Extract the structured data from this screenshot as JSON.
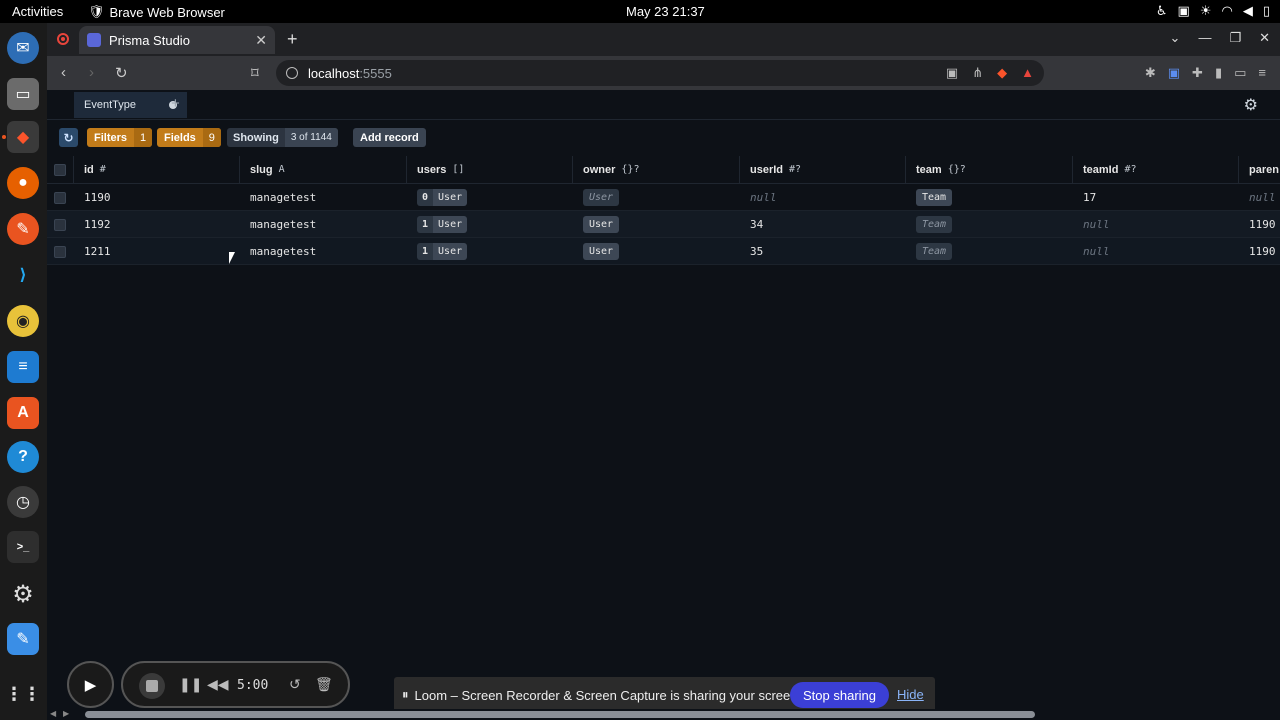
{
  "topbar": {
    "activities": "Activities",
    "app_name": "Brave Web Browser",
    "clock": "May 23  21:37"
  },
  "browser": {
    "tab_title": "Prisma Studio",
    "url_host": "localhost",
    "url_port": ":5555"
  },
  "studio": {
    "model_tab": "EventType",
    "filters_label": "Filters",
    "filters_count": "1",
    "fields_label": "Fields",
    "fields_count": "9",
    "showing_label": "Showing",
    "showing_count": "3 of 1144",
    "add_record": "Add record"
  },
  "table": {
    "columns": [
      {
        "name": "id",
        "type": "#"
      },
      {
        "name": "slug",
        "type": "A"
      },
      {
        "name": "users",
        "type": "[]"
      },
      {
        "name": "owner",
        "type": "{}?"
      },
      {
        "name": "userId",
        "type": "#?"
      },
      {
        "name": "team",
        "type": "{}?"
      },
      {
        "name": "teamId",
        "type": "#?"
      },
      {
        "name": "paren",
        "type": ""
      }
    ],
    "rows": [
      {
        "id": "1190",
        "slug": "managetest",
        "users_count": "0",
        "users_label": "User",
        "owner": "User",
        "userId": "null",
        "team": "Team",
        "teamId": "17",
        "parent": "null"
      },
      {
        "id": "1192",
        "slug": "managetest",
        "users_count": "1",
        "users_label": "User",
        "owner": "User",
        "userId": "34",
        "team": "Team",
        "teamId": "null",
        "parent": "1190"
      },
      {
        "id": "1211",
        "slug": "managetest",
        "users_count": "1",
        "users_label": "User",
        "owner": "User",
        "userId": "35",
        "team": "Team",
        "teamId": "null",
        "parent": "1190"
      }
    ]
  },
  "loom": {
    "timer": "5:00",
    "share_message": "Loom – Screen Recorder & Screen Capture is sharing your screen.",
    "stop_sharing": "Stop sharing",
    "hide": "Hide"
  }
}
